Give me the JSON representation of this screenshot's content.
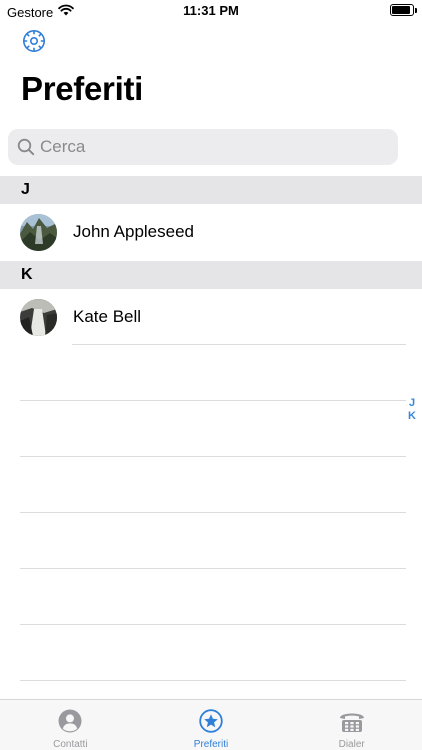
{
  "status_bar": {
    "carrier": "Gestore",
    "time": "11:31 PM",
    "battery_level": 0.9
  },
  "header": {
    "title": "Preferiti"
  },
  "search": {
    "placeholder": "Cerca",
    "value": ""
  },
  "sections": [
    {
      "letter": "J",
      "contacts": [
        {
          "name": "John Appleseed"
        }
      ]
    },
    {
      "letter": "K",
      "contacts": [
        {
          "name": "Kate Bell"
        }
      ]
    }
  ],
  "index": [
    "J",
    "K"
  ],
  "tab_bar": {
    "tabs": [
      {
        "label": "Contatti",
        "icon": "person-circle-icon",
        "active": false
      },
      {
        "label": "Preferiti",
        "icon": "star-circle-icon",
        "active": true
      },
      {
        "label": "Dialer",
        "icon": "phone-keypad-icon",
        "active": false
      }
    ]
  },
  "colors": {
    "accent": "#2f7fd8",
    "index_letters": "#3b86d9",
    "section_bg": "#e5e5e7",
    "search_bg": "#ececee"
  }
}
